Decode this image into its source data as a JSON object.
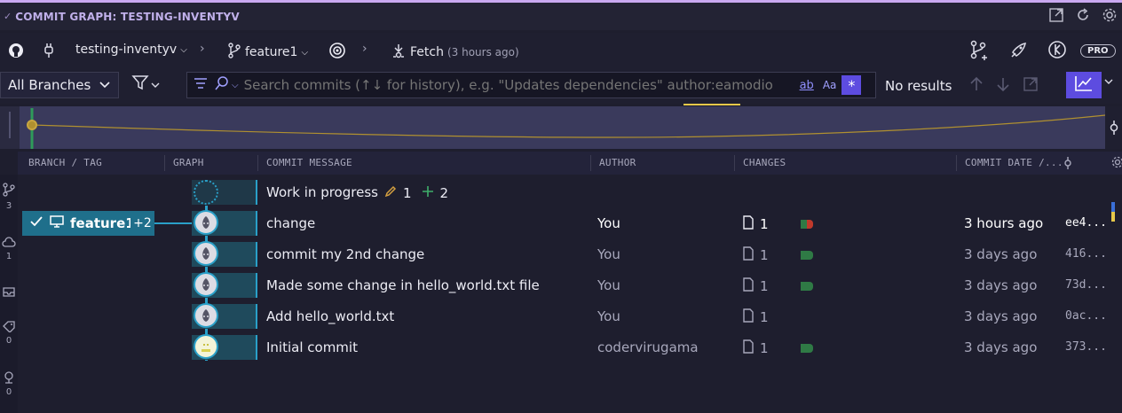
{
  "titlebar": {
    "title": "COMMIT GRAPH: TESTING-INVENTYV"
  },
  "toolbar": {
    "repo": "testing-inventyv",
    "branch": "feature1",
    "fetch_label": "Fetch",
    "fetch_time": "(3 hours ago)",
    "pro_label": "PRO"
  },
  "filter": {
    "branch_select": "All Branches",
    "search_placeholder": "Search commits (↑↓ for history), e.g. \"Updates dependencies\" author:eamodio",
    "opt_word": "ab",
    "opt_case": "Aa",
    "opt_regex": "*",
    "result_text": "No results"
  },
  "columns": {
    "branch_tag": "BRANCH / TAG",
    "graph": "GRAPH",
    "message": "COMMIT MESSAGE",
    "author": "AUTHOR",
    "changes": "CHANGES",
    "date": "COMMIT DATE /..."
  },
  "sidebar_counts": [
    "3",
    "1",
    "0",
    "0"
  ],
  "branch_label": {
    "name": "feature1",
    "plus": "+2"
  },
  "wip": {
    "message": "Work in progress",
    "modified": "1",
    "added": "2"
  },
  "commits": [
    {
      "message": "change",
      "author": "You",
      "changes": "1",
      "date": "3 hours ago",
      "sha": "ee4..."
    },
    {
      "message": "commit my 2nd change",
      "author": "You",
      "changes": "1",
      "date": "3 days ago",
      "sha": "416..."
    },
    {
      "message": "Made some change in hello_world.txt file",
      "author": "You",
      "changes": "1",
      "date": "3 days ago",
      "sha": "73d..."
    },
    {
      "message": "Add hello_world.txt",
      "author": "You",
      "changes": "1",
      "date": "3 days ago",
      "sha": "0ac..."
    },
    {
      "message": "Initial commit",
      "author": "codervirugama",
      "changes": "1",
      "date": "3 days ago",
      "sha": "373..."
    }
  ],
  "colors": {
    "accent": "#5d4ce0",
    "branch": "#1f6f8b",
    "graph_line": "#2aa0c8",
    "added": "#2f7a45",
    "deleted": "#c0392b"
  }
}
